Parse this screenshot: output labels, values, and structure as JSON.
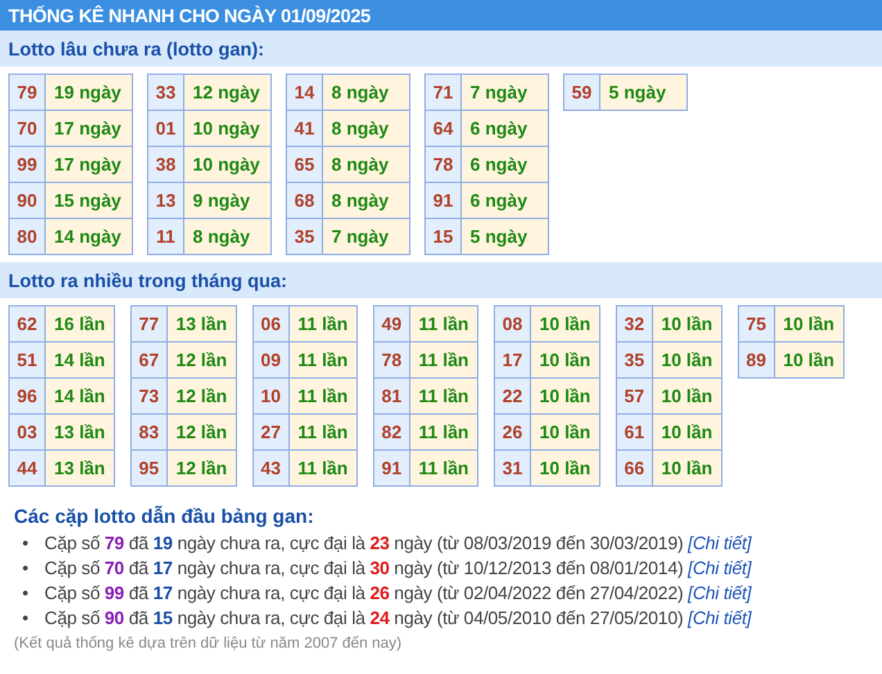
{
  "header": {
    "title": "THỐNG KÊ NHANH CHO NGÀY 01/09/2025"
  },
  "sections": [
    {
      "title": "Lotto lâu chưa ra (lotto gan):",
      "groups": [
        [
          {
            "number": "79",
            "value": "19 ngày"
          },
          {
            "number": "70",
            "value": "17 ngày"
          },
          {
            "number": "99",
            "value": "17 ngày"
          },
          {
            "number": "90",
            "value": "15 ngày"
          },
          {
            "number": "80",
            "value": "14 ngày"
          }
        ],
        [
          {
            "number": "33",
            "value": "12 ngày"
          },
          {
            "number": "01",
            "value": "10 ngày"
          },
          {
            "number": "38",
            "value": "10 ngày"
          },
          {
            "number": "13",
            "value": "9 ngày"
          },
          {
            "number": "11",
            "value": "8 ngày"
          }
        ],
        [
          {
            "number": "14",
            "value": "8 ngày"
          },
          {
            "number": "41",
            "value": "8 ngày"
          },
          {
            "number": "65",
            "value": "8 ngày"
          },
          {
            "number": "68",
            "value": "8 ngày"
          },
          {
            "number": "35",
            "value": "7 ngày"
          }
        ],
        [
          {
            "number": "71",
            "value": "7 ngày"
          },
          {
            "number": "64",
            "value": "6 ngày"
          },
          {
            "number": "78",
            "value": "6 ngày"
          },
          {
            "number": "91",
            "value": "6 ngày"
          },
          {
            "number": "15",
            "value": "5 ngày"
          }
        ],
        [
          {
            "number": "59",
            "value": "5 ngày"
          }
        ]
      ]
    },
    {
      "title": "Lotto ra nhiều trong tháng qua:",
      "groups": [
        [
          {
            "number": "62",
            "value": "16 lần"
          },
          {
            "number": "51",
            "value": "14 lần"
          },
          {
            "number": "96",
            "value": "14 lần"
          },
          {
            "number": "03",
            "value": "13 lần"
          },
          {
            "number": "44",
            "value": "13 lần"
          }
        ],
        [
          {
            "number": "77",
            "value": "13 lần"
          },
          {
            "number": "67",
            "value": "12 lần"
          },
          {
            "number": "73",
            "value": "12 lần"
          },
          {
            "number": "83",
            "value": "12 lần"
          },
          {
            "number": "95",
            "value": "12 lần"
          }
        ],
        [
          {
            "number": "06",
            "value": "11 lần"
          },
          {
            "number": "09",
            "value": "11 lần"
          },
          {
            "number": "10",
            "value": "11 lần"
          },
          {
            "number": "27",
            "value": "11 lần"
          },
          {
            "number": "43",
            "value": "11 lần"
          }
        ],
        [
          {
            "number": "49",
            "value": "11 lần"
          },
          {
            "number": "78",
            "value": "11 lần"
          },
          {
            "number": "81",
            "value": "11 lần"
          },
          {
            "number": "82",
            "value": "11 lần"
          },
          {
            "number": "91",
            "value": "11 lần"
          }
        ],
        [
          {
            "number": "08",
            "value": "10 lần"
          },
          {
            "number": "17",
            "value": "10 lần"
          },
          {
            "number": "22",
            "value": "10 lần"
          },
          {
            "number": "26",
            "value": "10 lần"
          },
          {
            "number": "31",
            "value": "10 lần"
          }
        ],
        [
          {
            "number": "32",
            "value": "10 lần"
          },
          {
            "number": "35",
            "value": "10 lần"
          },
          {
            "number": "57",
            "value": "10 lần"
          },
          {
            "number": "61",
            "value": "10 lần"
          },
          {
            "number": "66",
            "value": "10 lần"
          }
        ],
        [
          {
            "number": "75",
            "value": "10 lần"
          },
          {
            "number": "89",
            "value": "10 lần"
          }
        ]
      ]
    }
  ],
  "leaders": {
    "title": "Các cặp lotto dẫn đầu bảng gan:",
    "items": [
      {
        "segments": [
          {
            "kind": "plain",
            "text": "Cặp số "
          },
          {
            "kind": "pair",
            "text": "79"
          },
          {
            "kind": "plain",
            "text": " đã "
          },
          {
            "kind": "days",
            "text": "19"
          },
          {
            "kind": "plain",
            "text": " ngày chưa ra, cực đại là "
          },
          {
            "kind": "max",
            "text": "23"
          },
          {
            "kind": "plain",
            "text": " ngày (từ 08/03/2019 đến 30/03/2019) "
          }
        ],
        "link": "[Chi tiết]",
        "bullet": "•"
      },
      {
        "segments": [
          {
            "kind": "plain",
            "text": "Cặp số "
          },
          {
            "kind": "pair",
            "text": "70"
          },
          {
            "kind": "plain",
            "text": " đã "
          },
          {
            "kind": "days",
            "text": "17"
          },
          {
            "kind": "plain",
            "text": " ngày chưa ra, cực đại là "
          },
          {
            "kind": "max",
            "text": "30"
          },
          {
            "kind": "plain",
            "text": " ngày (từ 10/12/2013 đến 08/01/2014) "
          }
        ],
        "link": "[Chi tiết]",
        "bullet": "•"
      },
      {
        "segments": [
          {
            "kind": "plain",
            "text": "Cặp số "
          },
          {
            "kind": "pair",
            "text": "99"
          },
          {
            "kind": "plain",
            "text": " đã "
          },
          {
            "kind": "days",
            "text": "17"
          },
          {
            "kind": "plain",
            "text": " ngày chưa ra, cực đại là "
          },
          {
            "kind": "max",
            "text": "26"
          },
          {
            "kind": "plain",
            "text": " ngày (từ 02/04/2022 đến 27/04/2022) "
          }
        ],
        "link": "[Chi tiết]",
        "bullet": "•"
      },
      {
        "segments": [
          {
            "kind": "plain",
            "text": "Cặp số "
          },
          {
            "kind": "pair",
            "text": "90"
          },
          {
            "kind": "plain",
            "text": " đã "
          },
          {
            "kind": "days",
            "text": "15"
          },
          {
            "kind": "plain",
            "text": " ngày chưa ra, cực đại là "
          },
          {
            "kind": "max",
            "text": "24"
          },
          {
            "kind": "plain",
            "text": " ngày (từ 04/05/2010 đến 27/05/2010) "
          }
        ],
        "link": "[Chi tiết]",
        "bullet": "•"
      }
    ]
  },
  "footnote": "(Kết quả thống kê dựa trên dữ liệu từ năm 2007 đến nay)"
}
